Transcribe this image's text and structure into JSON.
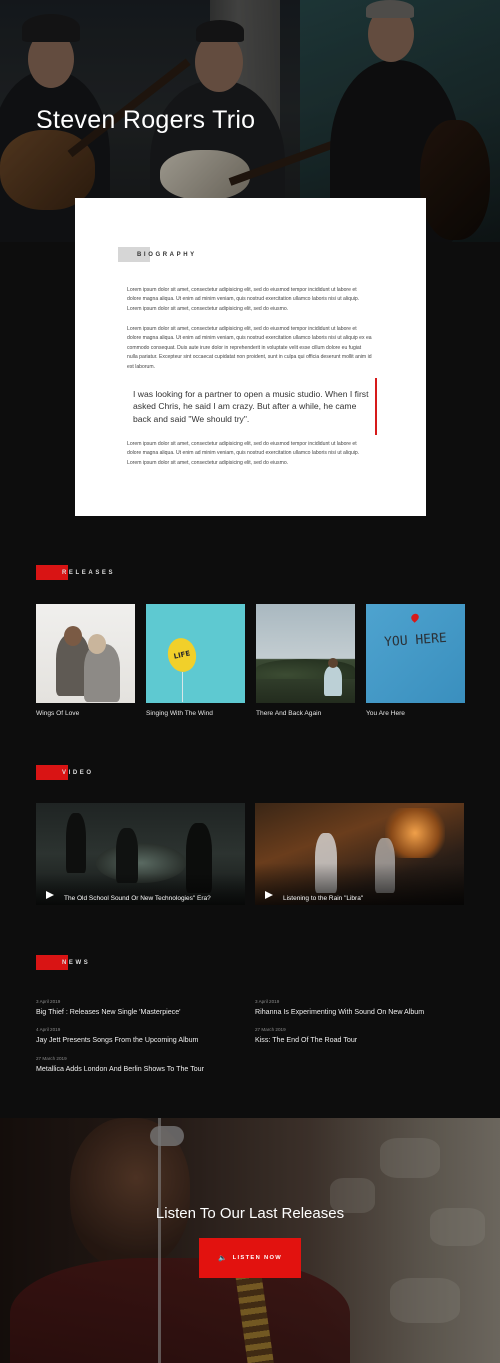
{
  "hero": {
    "title": "Steven Rogers Trio"
  },
  "biography": {
    "tag": "BIOGRAPHY",
    "paragraphs": [
      "Lorem ipsum dolor sit amet, consectetur adipisicing elit, sed do eiusmod tempor incididunt ut labore et dolore magna aliqua. Ut enim ad minim veniam, quis nostrud exercitation ullamco laboris nisi ut aliquip. Lorem ipsum dolor sit amet, consectetur adipisicing elit, sed do eiusmo.",
      "Lorem ipsum dolor sit amet, consectetur adipisicing elit, sed do eiusmod tempor incididunt ut labore et dolore magna aliqua. Ut enim ad minim veniam, quis nostrud exercitation ullamco laboris nisi ut aliquip ex ea commodo consequat. Duis aute irure dolor in reprehenderit in voluptate velit esse cillum dolore eu fugiat nulla pariatur. Excepteur sint occaecat cupidatat non proident, sunt in culpa qui officia deserunt mollit anim id est laborum.",
      "Lorem ipsum dolor sit amet, consectetur adipisicing elit, sed do eiusmod tempor incididunt ut labore et dolore magna aliqua. Ut enim ad minim veniam, quis nostrud exercitation ullamco laboris nisi ut aliquip. Lorem ipsum dolor sit amet, consectetur adipisicing elit, sed do eiusmo."
    ],
    "quote": "I was looking for a partner to open a music studio. When I first asked Chris, he said I am crazy. But after a while, he came back and said \"We should try\".",
    "accent_color": "#d61a1a"
  },
  "releases": {
    "tag": "RELEASES",
    "items": [
      {
        "title": "Wings Of Love",
        "image": "couple-embrace"
      },
      {
        "title": "Singing With The Wind",
        "image": "yellow-balloon-life"
      },
      {
        "title": "There And Back Again",
        "image": "person-on-hill"
      },
      {
        "title": "You Are Here",
        "image": "you-here-wall"
      }
    ],
    "balloon_text": "LIFE",
    "wall_text": "YOU HERE"
  },
  "video": {
    "tag": "VIDEO",
    "items": [
      {
        "title": "The Old School Sound Or New Technologies\" Era?"
      },
      {
        "title": "Listening to the Rain \"Libra\""
      }
    ]
  },
  "news": {
    "tag": "NEWS",
    "left": [
      {
        "date": "3 April 2019",
        "title": "Big Thief : Releases New Single 'Masterpiece'"
      },
      {
        "date": "4 April 2019",
        "title": "Jay Jett Presents Songs From the Upcoming Album"
      },
      {
        "date": "27 March 2019",
        "title": "Metallica Adds London And Berlin Shows To The Tour"
      }
    ],
    "right": [
      {
        "date": "3 April 2019",
        "title": "Rihanna Is Experimenting With Sound On New Album"
      },
      {
        "date": "27 March 2019",
        "title": "Kiss: The End Of The Road Tour"
      }
    ]
  },
  "cta": {
    "title": "Listen To Our Last Releases",
    "button_label": "LISTEN NOW",
    "button_icon": "speaker-icon",
    "button_color": "#e2120f"
  }
}
